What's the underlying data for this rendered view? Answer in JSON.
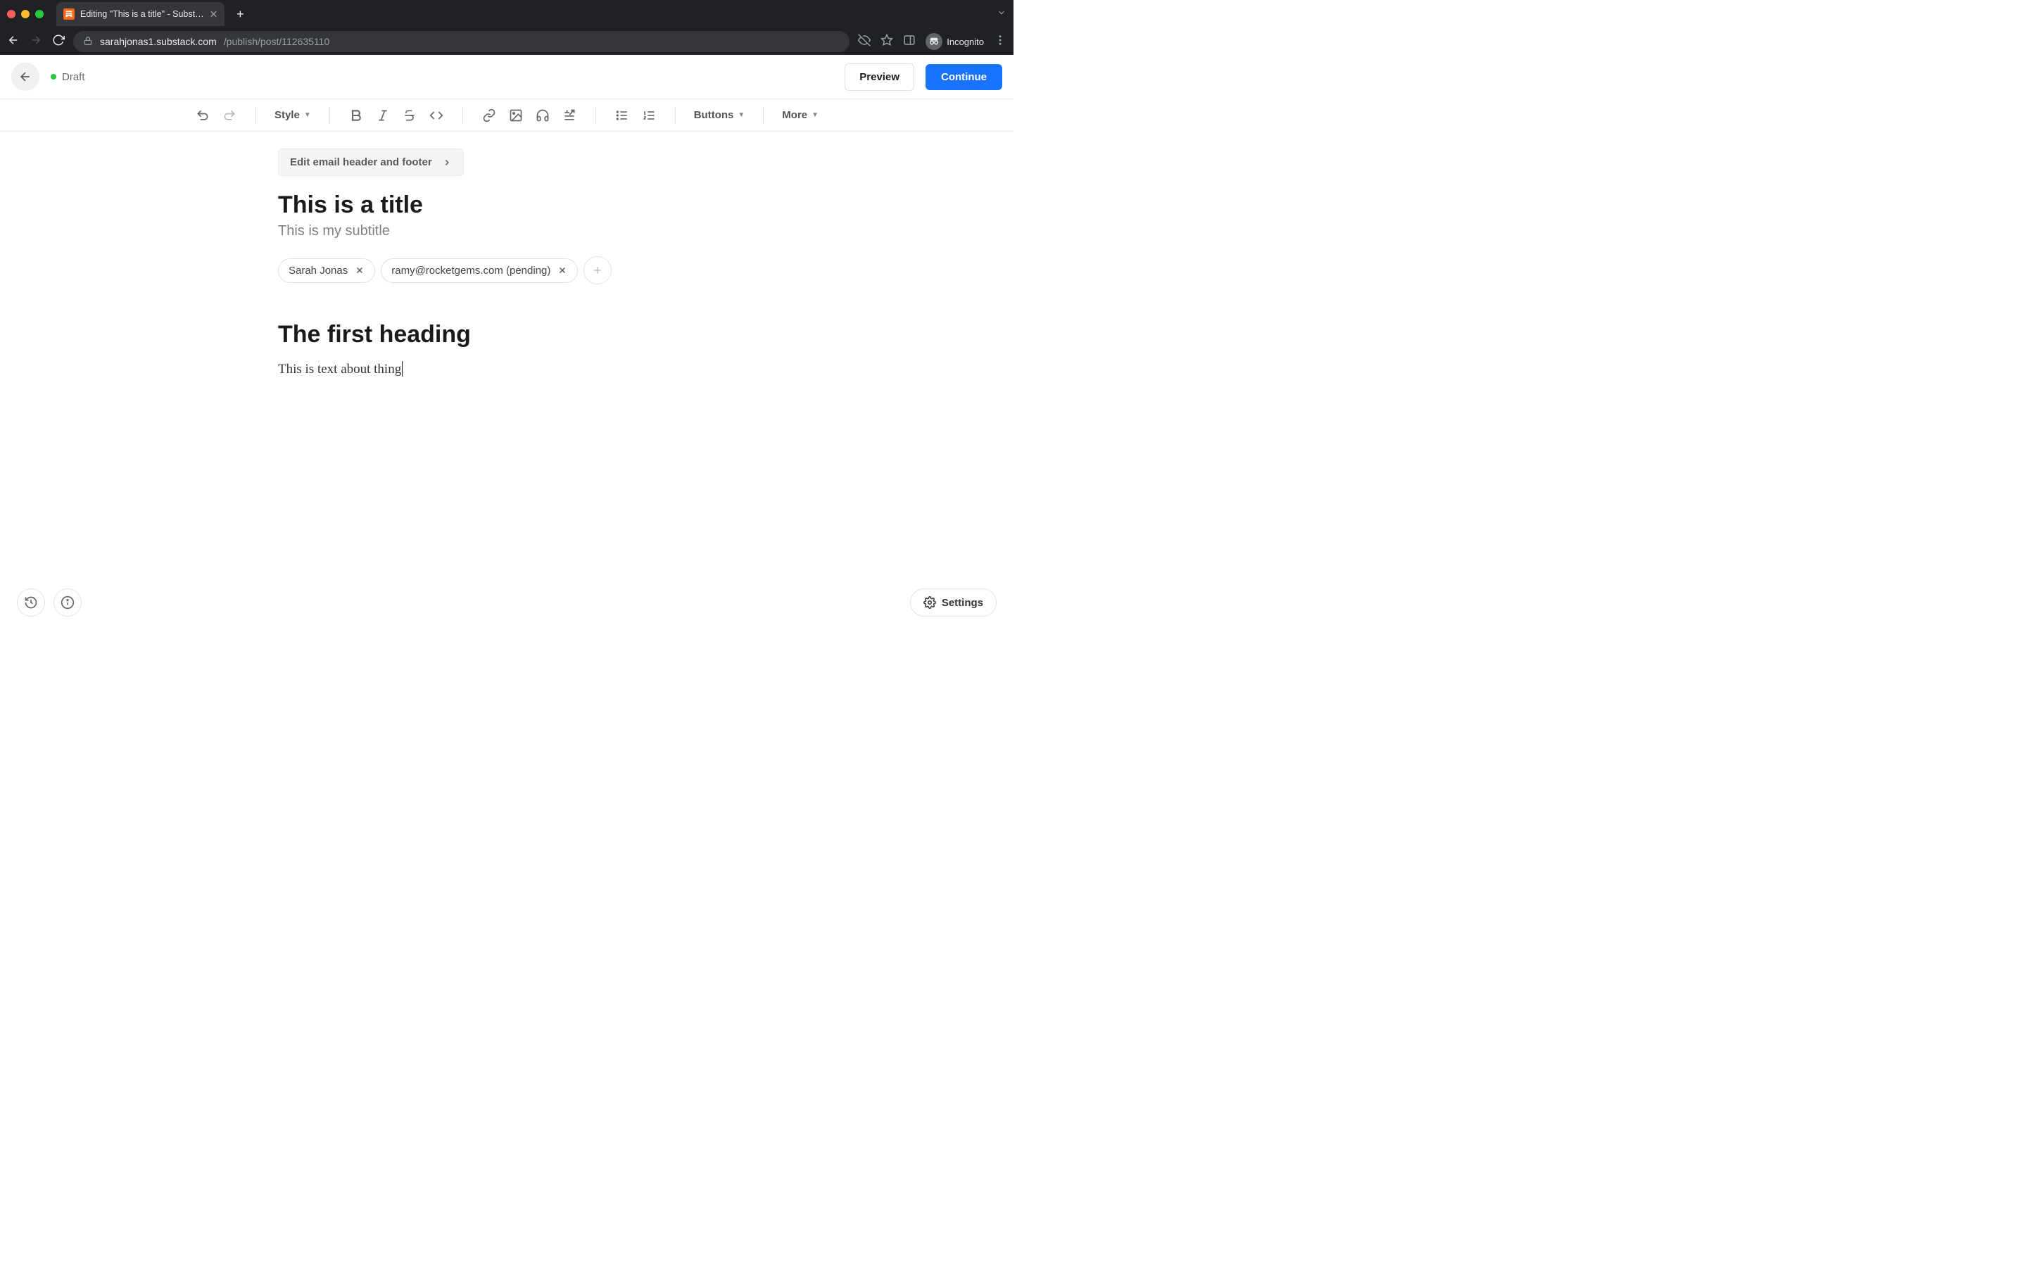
{
  "browser": {
    "tab_title": "Editing \"This is a title\" - Subst…",
    "url_domain": "sarahjonas1.substack.com",
    "url_path": "/publish/post/112635110",
    "incognito_label": "Incognito"
  },
  "header": {
    "status": "Draft",
    "preview_label": "Preview",
    "continue_label": "Continue"
  },
  "toolbar": {
    "style_label": "Style",
    "buttons_label": "Buttons",
    "more_label": "More"
  },
  "editor": {
    "email_header_button": "Edit email header and footer",
    "title": "This is a title",
    "subtitle": "This is my subtitle",
    "authors": [
      {
        "label": "Sarah Jonas"
      },
      {
        "label": "ramy@rocketgems.com (pending)"
      }
    ],
    "body": {
      "heading": "The first heading",
      "paragraph": "This is text about thing"
    }
  },
  "bottom": {
    "settings_label": "Settings"
  }
}
